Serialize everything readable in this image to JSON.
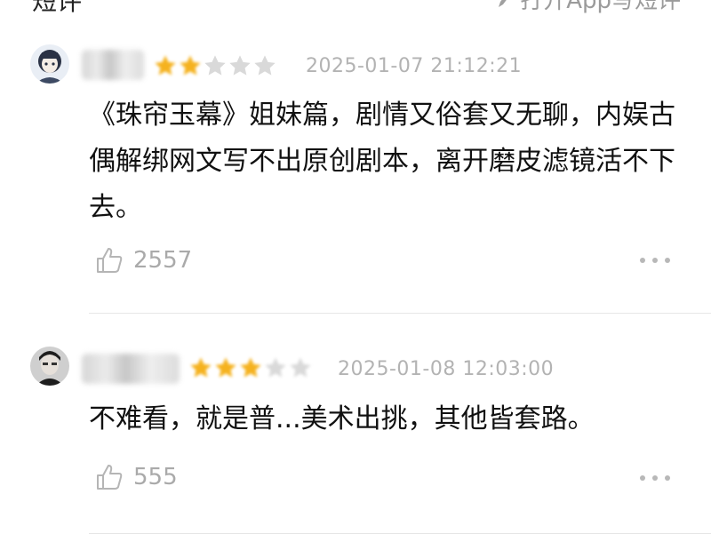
{
  "header": {
    "title": "短评",
    "write_label": "打开App写短评"
  },
  "reviews": [
    {
      "rating": 2,
      "time": "2025-01-07 21:12:21",
      "content": "《珠帘玉幕》姐妹篇，剧情又俗套又无聊，内娱古偶解绑网文写不出原创剧本，离开磨皮滤镜活不下去。",
      "likes": "2557"
    },
    {
      "rating": 3,
      "time": "2025-01-08 12:03:00",
      "content": "不难看，就是普...美术出挑，其他皆套路。",
      "likes": "555"
    }
  ],
  "colors": {
    "star_on": "#f5b21f",
    "star_off": "#d9d9d9",
    "meta": "#b3b3b3"
  },
  "icons": [
    "pen-icon",
    "star-icon",
    "thumb-up-icon",
    "more-icon"
  ]
}
